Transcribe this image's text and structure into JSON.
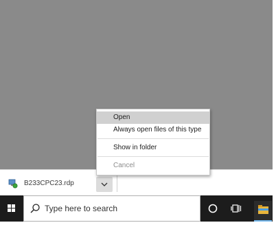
{
  "download": {
    "filename": "B233CPC23.rdp"
  },
  "context_menu": {
    "items": [
      {
        "label": "Open"
      },
      {
        "label": "Always open files of this type"
      },
      {
        "label": "Show in folder"
      },
      {
        "label": "Cancel"
      }
    ]
  },
  "taskbar": {
    "search_placeholder": "Type here to search"
  },
  "icons": [
    "file-rdp-icon",
    "chevron-down-icon",
    "windows-start-icon",
    "search-icon",
    "cortana-circle-icon",
    "task-view-icon",
    "file-explorer-icon"
  ],
  "colors": {
    "page_area": "#8a8a8a",
    "menu_hover": "#d0d0d0",
    "taskbar": "#1c1c1c"
  }
}
